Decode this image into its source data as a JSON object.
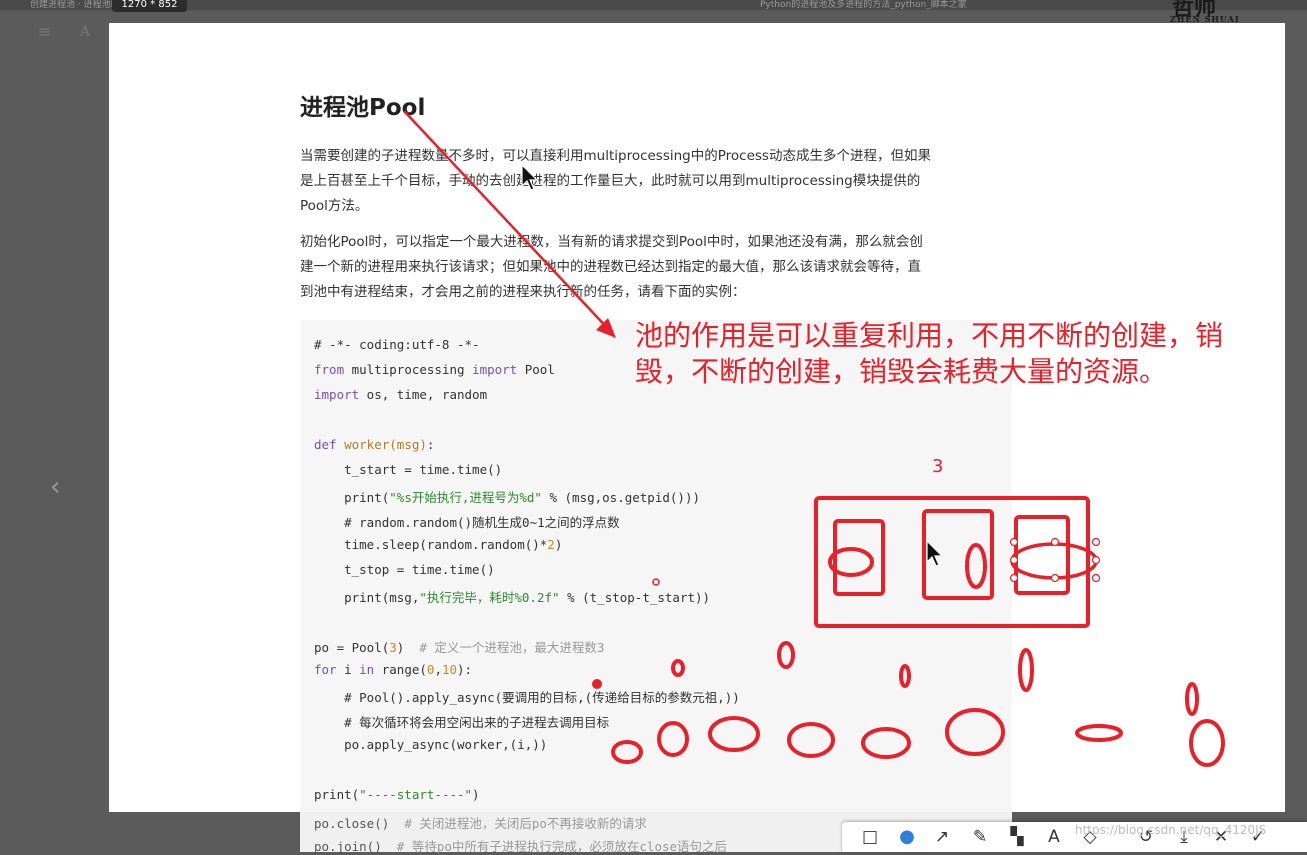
{
  "window": {
    "dimensions_tag": "1270 * 852",
    "top_left_text": "创建进程池 · 进程池Pool · 多进程编程",
    "top_mid_text": "Python的进程池及多进程的方法_python_脚本之家",
    "logo_big": "哲帅",
    "logo_small": "ZHEN SHUAI"
  },
  "reader": {
    "menu_icon": "≡",
    "font_icon": "A",
    "prev_arrow": "‹",
    "next_arrow": "›"
  },
  "article": {
    "title": "进程池Pool",
    "para1": [
      "当需要创建的子进程数量不多时，可以直接利用multiprocessing中的Process动态成生多个进程，但如果",
      "是上百甚至上千个目标，手动的去创建进程的工作量巨大，此时就可以用到multiprocessing模块提供的",
      "Pool方法。"
    ],
    "para2": [
      "初始化Pool时，可以指定一个最大进程数，当有新的请求提交到Pool中时，如果池还没有满，那么就会创",
      "建一个新的进程用来执行该请求；但如果池中的进程数已经达到指定的最大值，那么该请求就会等待，直",
      "到池中有进程结束，才会用之前的进程来执行新的任务，请看下面的实例："
    ]
  },
  "code": {
    "l1": "# -*- coding:utf-8 -*-",
    "l2_a": "from",
    "l2_b": " multiprocessing ",
    "l2_c": "import",
    "l2_d": " Pool",
    "l3_a": "import",
    "l3_b": " os, time, random",
    "l5_a": "def",
    "l5_b": " worker",
    "l5_c": "(msg)",
    "l5_d": ":",
    "l6": "    t_start = time.time()",
    "l7_a": "    print(",
    "l7_b": "\"%s开始执行,进程号为%d\"",
    "l7_c": " % (msg,os.getpid()))",
    "l8": "    # random.random()随机生成0~1之间的浮点数",
    "l9_a": "    time.sleep(random.random()*",
    "l9_b": "2",
    "l9_c": ")",
    "l10": "    t_stop = time.time()",
    "l11_a": "    print(msg,",
    "l11_b": "\"执行完毕，耗时%0.2f\"",
    "l11_c": " % (t_stop-t_start))",
    "l13_a": "po = Pool(",
    "l13_b": "3",
    "l13_c": ")  ",
    "l13_d": "# 定义一个进程池，最大进程数3",
    "l14_a": "for",
    "l14_b": " i ",
    "l14_c": "in",
    "l14_d": " range(",
    "l14_e": "0",
    "l14_f": ",",
    "l14_g": "10",
    "l14_h": "):",
    "l15": "    # Pool().apply_async(要调用的目标,(传递给目标的参数元祖,))",
    "l16": "    # 每次循环将会用空闲出来的子进程去调用目标",
    "l17": "    po.apply_async(worker,(i,))",
    "l19_a": "print(",
    "l19_b": "\"----start----\"",
    "l19_c": ")",
    "l20_a": "po.close()",
    "l20_b": "  # 关闭进程池，关闭后po不再接收新的请求",
    "l21_a": "po.join()",
    "l21_b": "  # 等待po中所有子进程执行完成，必须放在close语句之后"
  },
  "annotation": {
    "line1": "池的作用是可以重复利用，不用不断的创建，销",
    "line2": "毁，不断的创建，销毁会耗费大量的资源。",
    "number": "3",
    "ink_color": "#e8202a"
  },
  "toolbar": {
    "rect": "□",
    "circle": "●",
    "arrow": "↗",
    "pen": "✎",
    "mosaic": "▚",
    "text": "A",
    "eraser": "◇",
    "undo": "↺",
    "save": "⤓",
    "cancel": "✕",
    "done": "✓"
  },
  "watermark": "https://blog.csdn.net/qq_4120JS"
}
